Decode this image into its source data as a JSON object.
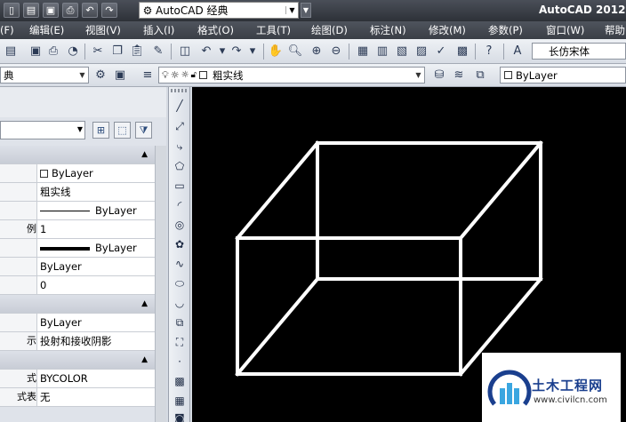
{
  "titlebar": {
    "workspace": "AutoCAD 经典",
    "app_title": "AutoCAD 2012"
  },
  "menus": [
    "(F)",
    "编辑(E)",
    "视图(V)",
    "插入(I)",
    "格式(O)",
    "工具(T)",
    "绘图(D)",
    "标注(N)",
    "修改(M)",
    "参数(P)",
    "窗口(W)",
    "帮助"
  ],
  "toolbar": {
    "text_style": "长仿宋体",
    "workspace_combo": "典",
    "layer": "粗实线",
    "color": "ByLayer"
  },
  "properties": {
    "rows": [
      {
        "key": "",
        "value": "",
        "section": true
      },
      {
        "key": "",
        "value": "ByLayer",
        "checkbox": true
      },
      {
        "key": "",
        "value": "粗实线"
      },
      {
        "key": "",
        "value": "ByLayer",
        "linetype": true
      },
      {
        "key": "例",
        "value": "1"
      },
      {
        "key": "",
        "value": "ByLayer",
        "lineweight": true
      },
      {
        "key": "",
        "value": "ByLayer"
      },
      {
        "key": "",
        "value": "0"
      },
      {
        "key": "",
        "value": "",
        "section": true
      },
      {
        "key": "",
        "value": "ByLayer"
      },
      {
        "key": "示",
        "value": "投射和接收阴影"
      },
      {
        "key": "",
        "value": "",
        "section": true
      },
      {
        "key": "式",
        "value": "BYCOLOR"
      },
      {
        "key": "式表",
        "value": "无"
      }
    ]
  },
  "watermark": {
    "name": "土木工程网",
    "url": "www.civilcn.com"
  },
  "colors": {
    "canvas": "#000000",
    "geometry": "#ffffff",
    "watermark": "#1a3f8e"
  }
}
